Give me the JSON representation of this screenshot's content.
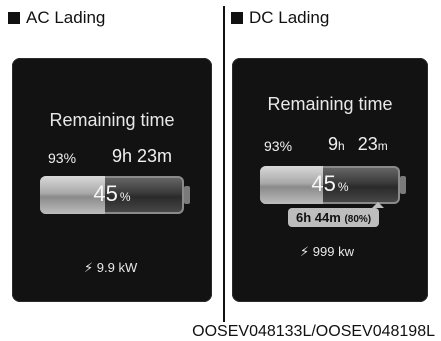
{
  "ac": {
    "section_label": "AC Lading",
    "title": "Remaining time",
    "battery_pct": "93%",
    "remaining_time": "9h 23m",
    "charge_level": "45",
    "charge_unit": "%",
    "charge_fraction": 0.45,
    "power": "9.9 kW"
  },
  "dc": {
    "section_label": "DC Lading",
    "title": "Remaining time",
    "battery_pct": "93%",
    "remaining_hours": "9",
    "hours_unit": "h",
    "remaining_minutes": "23",
    "minutes_unit": "m",
    "charge_level": "45",
    "charge_unit": "%",
    "charge_fraction": 0.45,
    "tooltip_time": "6h 44m",
    "tooltip_target": "(80%)",
    "power": "999 kw"
  },
  "caption": "OOSEV048133L/OOSEV048198L",
  "icons": {
    "bolt": "lightning-bolt-icon",
    "square": "square-bullet-icon"
  }
}
